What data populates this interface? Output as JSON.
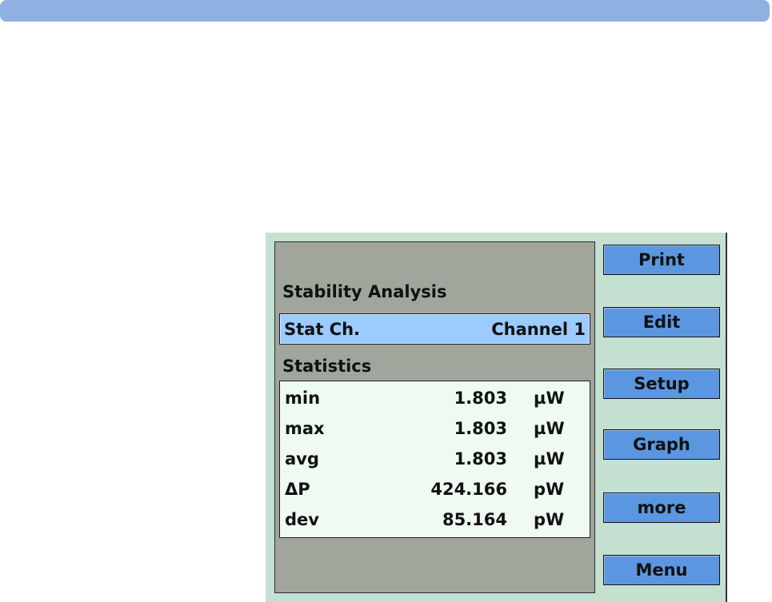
{
  "colors": {
    "top_bar": "#8fb1e2",
    "panel_background": "#c4e0d1",
    "display_background": "#a0a69c",
    "selected_row": "#9bcbff",
    "stats_background": "#eefaf2",
    "button": "#5b97e0"
  },
  "display": {
    "title": "Stability Analysis",
    "channel": {
      "label": "Stat Ch.",
      "value": "Channel 1"
    },
    "statistics_title": "Statistics",
    "stats": [
      {
        "label": "min",
        "value": "1.803",
        "unit": "µW"
      },
      {
        "label": "max",
        "value": "1.803",
        "unit": "µW"
      },
      {
        "label": "avg",
        "value": "1.803",
        "unit": "µW"
      },
      {
        "label": "ΔP",
        "value": "424.166",
        "unit": "pW"
      },
      {
        "label": "dev",
        "value": "85.164",
        "unit": "pW"
      }
    ]
  },
  "softkeys": {
    "print": "Print",
    "edit": "Edit",
    "setup": "Setup",
    "graph": "Graph",
    "more": "more",
    "menu": "Menu"
  }
}
